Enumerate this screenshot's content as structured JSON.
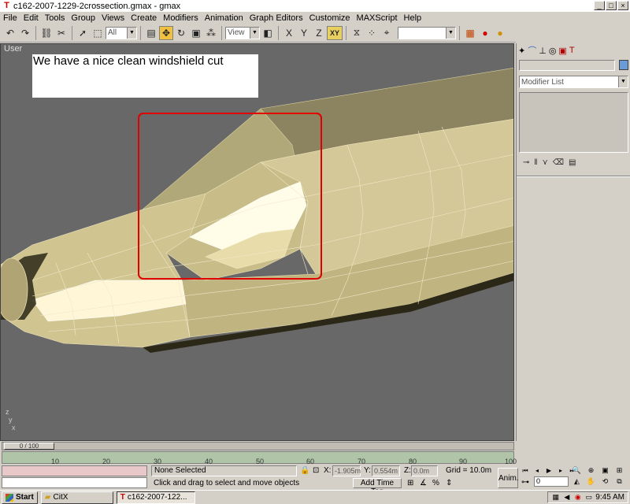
{
  "window": {
    "title": "c162-2007-1229-2crossection.gmax - gmax",
    "controls": [
      "_",
      "□",
      "×"
    ]
  },
  "menu": [
    "File",
    "Edit",
    "Tools",
    "Group",
    "Views",
    "Create",
    "Modifiers",
    "Animation",
    "Graph Editors",
    "Customize",
    "MAXScript",
    "Help"
  ],
  "toolbar": {
    "selection_filter": "All",
    "reference_coord": "View",
    "constraint_xy": "XY"
  },
  "viewport": {
    "label": "User",
    "annotation": "We have a nice clean windshield cut",
    "highlight_color": "#e00000",
    "axis_labels": {
      "z": "z",
      "y": "y",
      "x": "x"
    }
  },
  "command_panel": {
    "modifier_list": "Modifier List",
    "object_color": "#6a9ad8"
  },
  "timeline": {
    "frame_counter": "0 / 100",
    "ticks": [
      "10",
      "20",
      "30",
      "40",
      "50",
      "60",
      "70",
      "80",
      "90",
      "100"
    ]
  },
  "status": {
    "selection": "None Selected",
    "prompt": "Click and drag to select and move objects",
    "x_label": "X:",
    "x_value": "-1.905m",
    "y_label": "Y:",
    "y_value": "0.554m",
    "z_label": "Z:",
    "z_value": "0.0m",
    "grid": "Grid = 10.0m",
    "add_time_tag": "Add Time Tag",
    "anim": "Anim.",
    "current_frame": "0"
  },
  "taskbar": {
    "start": "Start",
    "tasks": [
      {
        "label": "CitX"
      },
      {
        "label": "c162-2007-122..."
      }
    ],
    "clock": "9:45 AM"
  }
}
